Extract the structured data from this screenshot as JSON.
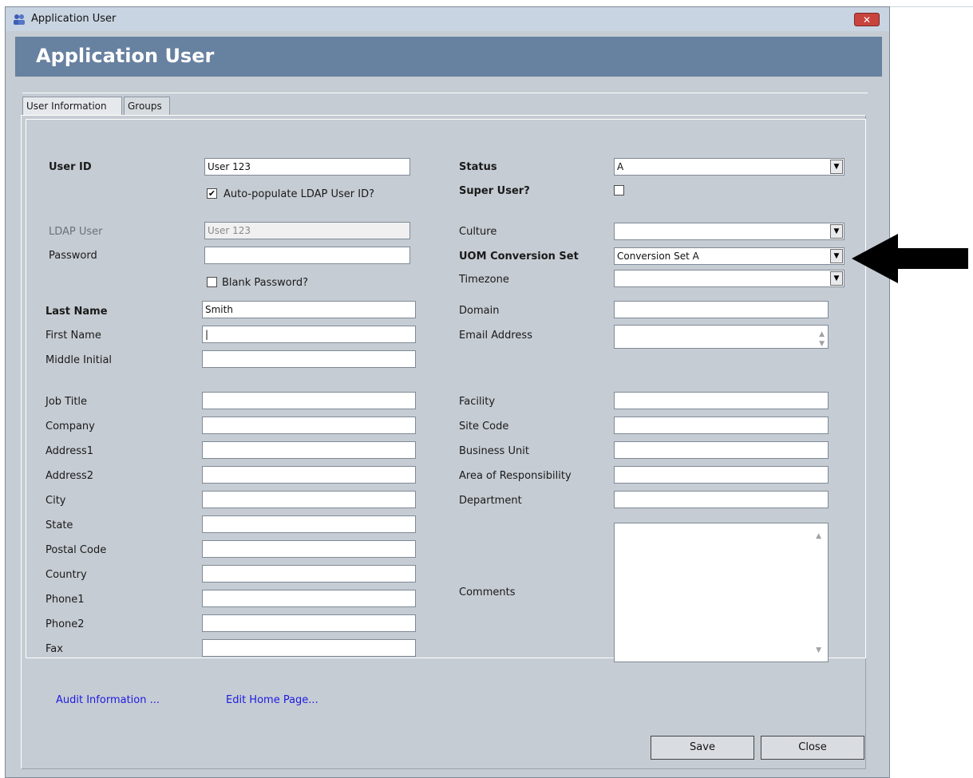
{
  "window": {
    "title": "Application User",
    "close_label": "✕"
  },
  "header": {
    "title": "Application User"
  },
  "tabs": [
    {
      "label": "User Information",
      "active": true
    },
    {
      "label": "Groups",
      "active": false
    }
  ],
  "left": {
    "user_id": {
      "label": "User ID",
      "value": "User 123"
    },
    "auto_ldap": {
      "label": "Auto-populate LDAP User ID?",
      "checked": true
    },
    "ldap_user": {
      "label": "LDAP User",
      "value": "User 123"
    },
    "password": {
      "label": "Password",
      "value": ""
    },
    "blank_password": {
      "label": "Blank Password?",
      "checked": false
    },
    "last_name": {
      "label": "Last Name",
      "value": "Smith"
    },
    "first_name": {
      "label": "First Name",
      "value": "|"
    },
    "middle_initial": {
      "label": "Middle Initial",
      "value": ""
    },
    "job_title": {
      "label": "Job Title",
      "value": ""
    },
    "company": {
      "label": "Company",
      "value": ""
    },
    "address1": {
      "label": "Address1",
      "value": ""
    },
    "address2": {
      "label": "Address2",
      "value": ""
    },
    "city": {
      "label": "City",
      "value": ""
    },
    "state": {
      "label": "State",
      "value": ""
    },
    "postal_code": {
      "label": "Postal Code",
      "value": ""
    },
    "country": {
      "label": "Country",
      "value": ""
    },
    "phone1": {
      "label": "Phone1",
      "value": ""
    },
    "phone2": {
      "label": "Phone2",
      "value": ""
    },
    "fax": {
      "label": "Fax",
      "value": ""
    }
  },
  "right": {
    "status": {
      "label": "Status",
      "value": "A"
    },
    "super_user": {
      "label": "Super User?",
      "checked": false
    },
    "culture": {
      "label": "Culture",
      "value": ""
    },
    "uom_conversion_set": {
      "label": "UOM Conversion Set",
      "value": "Conversion Set A"
    },
    "timezone": {
      "label": "Timezone",
      "value": ""
    },
    "domain": {
      "label": "Domain",
      "value": ""
    },
    "email": {
      "label": "Email Address",
      "value": ""
    },
    "facility": {
      "label": "Facility",
      "value": ""
    },
    "site_code": {
      "label": "Site Code",
      "value": ""
    },
    "business_unit": {
      "label": "Business Unit",
      "value": ""
    },
    "area_of_responsibility": {
      "label": "Area of Responsibility",
      "value": ""
    },
    "department": {
      "label": "Department",
      "value": ""
    },
    "comments": {
      "label": "Comments",
      "value": ""
    }
  },
  "links": {
    "audit": "Audit Information ...",
    "edit_home": "Edit Home Page..."
  },
  "buttons": {
    "save": "Save",
    "close": "Close"
  },
  "icons": {
    "window_icon": "users-group-icon",
    "dropdown": "chevron-down-icon",
    "arrow": "arrow-left-pointer"
  },
  "colors": {
    "header": "#6781a0",
    "panel": "#c6ccd3",
    "link": "#1b1be0"
  }
}
